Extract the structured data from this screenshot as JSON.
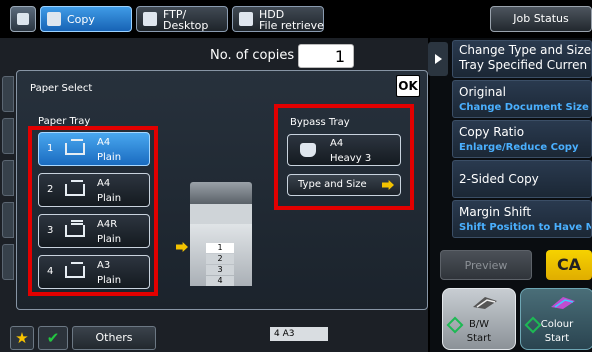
{
  "topbar": {
    "tabs": [
      {
        "label": "Copy",
        "active": true,
        "icon": "copy-icon"
      },
      {
        "label": "FTP/\nDesktop",
        "active": false,
        "icon": "ftp-icon"
      },
      {
        "label": "HDD\nFile retrieve",
        "active": false,
        "icon": "hdd-icon"
      }
    ],
    "job_status": "Job Status"
  },
  "copies": {
    "label": "No. of copies",
    "value": "1"
  },
  "dialog": {
    "title": "Paper Select",
    "ok": "OK",
    "paper_tray_label": "Paper Tray",
    "trays": [
      {
        "num": "1",
        "size": "A4",
        "type": "Plain",
        "selected": true
      },
      {
        "num": "2",
        "size": "A4",
        "type": "Plain",
        "selected": false
      },
      {
        "num": "3",
        "size": "A4R",
        "type": "Plain",
        "selected": false
      },
      {
        "num": "4",
        "size": "A3",
        "type": "Plain",
        "selected": false
      }
    ],
    "bypass": {
      "label": "Bypass Tray",
      "size": "A4",
      "type": "Heavy 3",
      "type_size_button": "Type and Size"
    },
    "copier_tray_markers": [
      "1",
      "2",
      "3",
      "4"
    ]
  },
  "right_panel": {
    "functions": [
      {
        "title": "Change Type and Size\nTray Specified Curren",
        "sub": ""
      },
      {
        "title": "Original",
        "sub": "Change Document Size"
      },
      {
        "title": "Copy Ratio",
        "sub": "Enlarge/Reduce Copy"
      },
      {
        "title": "2-Sided Copy",
        "sub": ""
      },
      {
        "title": "Margin Shift",
        "sub": "Shift Position to Have M"
      }
    ],
    "preview": "Preview",
    "ca": "CA",
    "bw_start": {
      "line1": "B/W",
      "line2": "Start"
    },
    "colour_start": {
      "line1": "Colour",
      "line2": "Start"
    }
  },
  "bottom": {
    "others": "Others",
    "paper_indicator": "4   A3"
  },
  "colors": {
    "accent_blue": "#1a6bc0",
    "highlight_red": "#e20000",
    "ca_yellow": "#f6d200",
    "link_blue": "#4ab0ff"
  }
}
